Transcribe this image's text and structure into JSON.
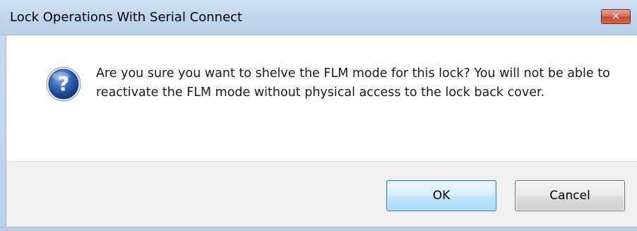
{
  "window": {
    "title": "Lock Operations With Serial Connect",
    "close_label": "✕"
  },
  "dialog": {
    "icon": "question-icon",
    "message": "Are you sure you want to shelve the FLM mode for this lock?  You will not be able to reactivate the FLM mode without physical access to the lock back cover."
  },
  "buttons": {
    "ok_label": "OK",
    "cancel_label": "Cancel"
  },
  "colors": {
    "titlebar": "#c2d7ee",
    "close_button": "#c8472f",
    "footer": "#f0f0f0",
    "default_button_border": "#3c7fb1",
    "icon_blue": "#2d5fb3"
  }
}
